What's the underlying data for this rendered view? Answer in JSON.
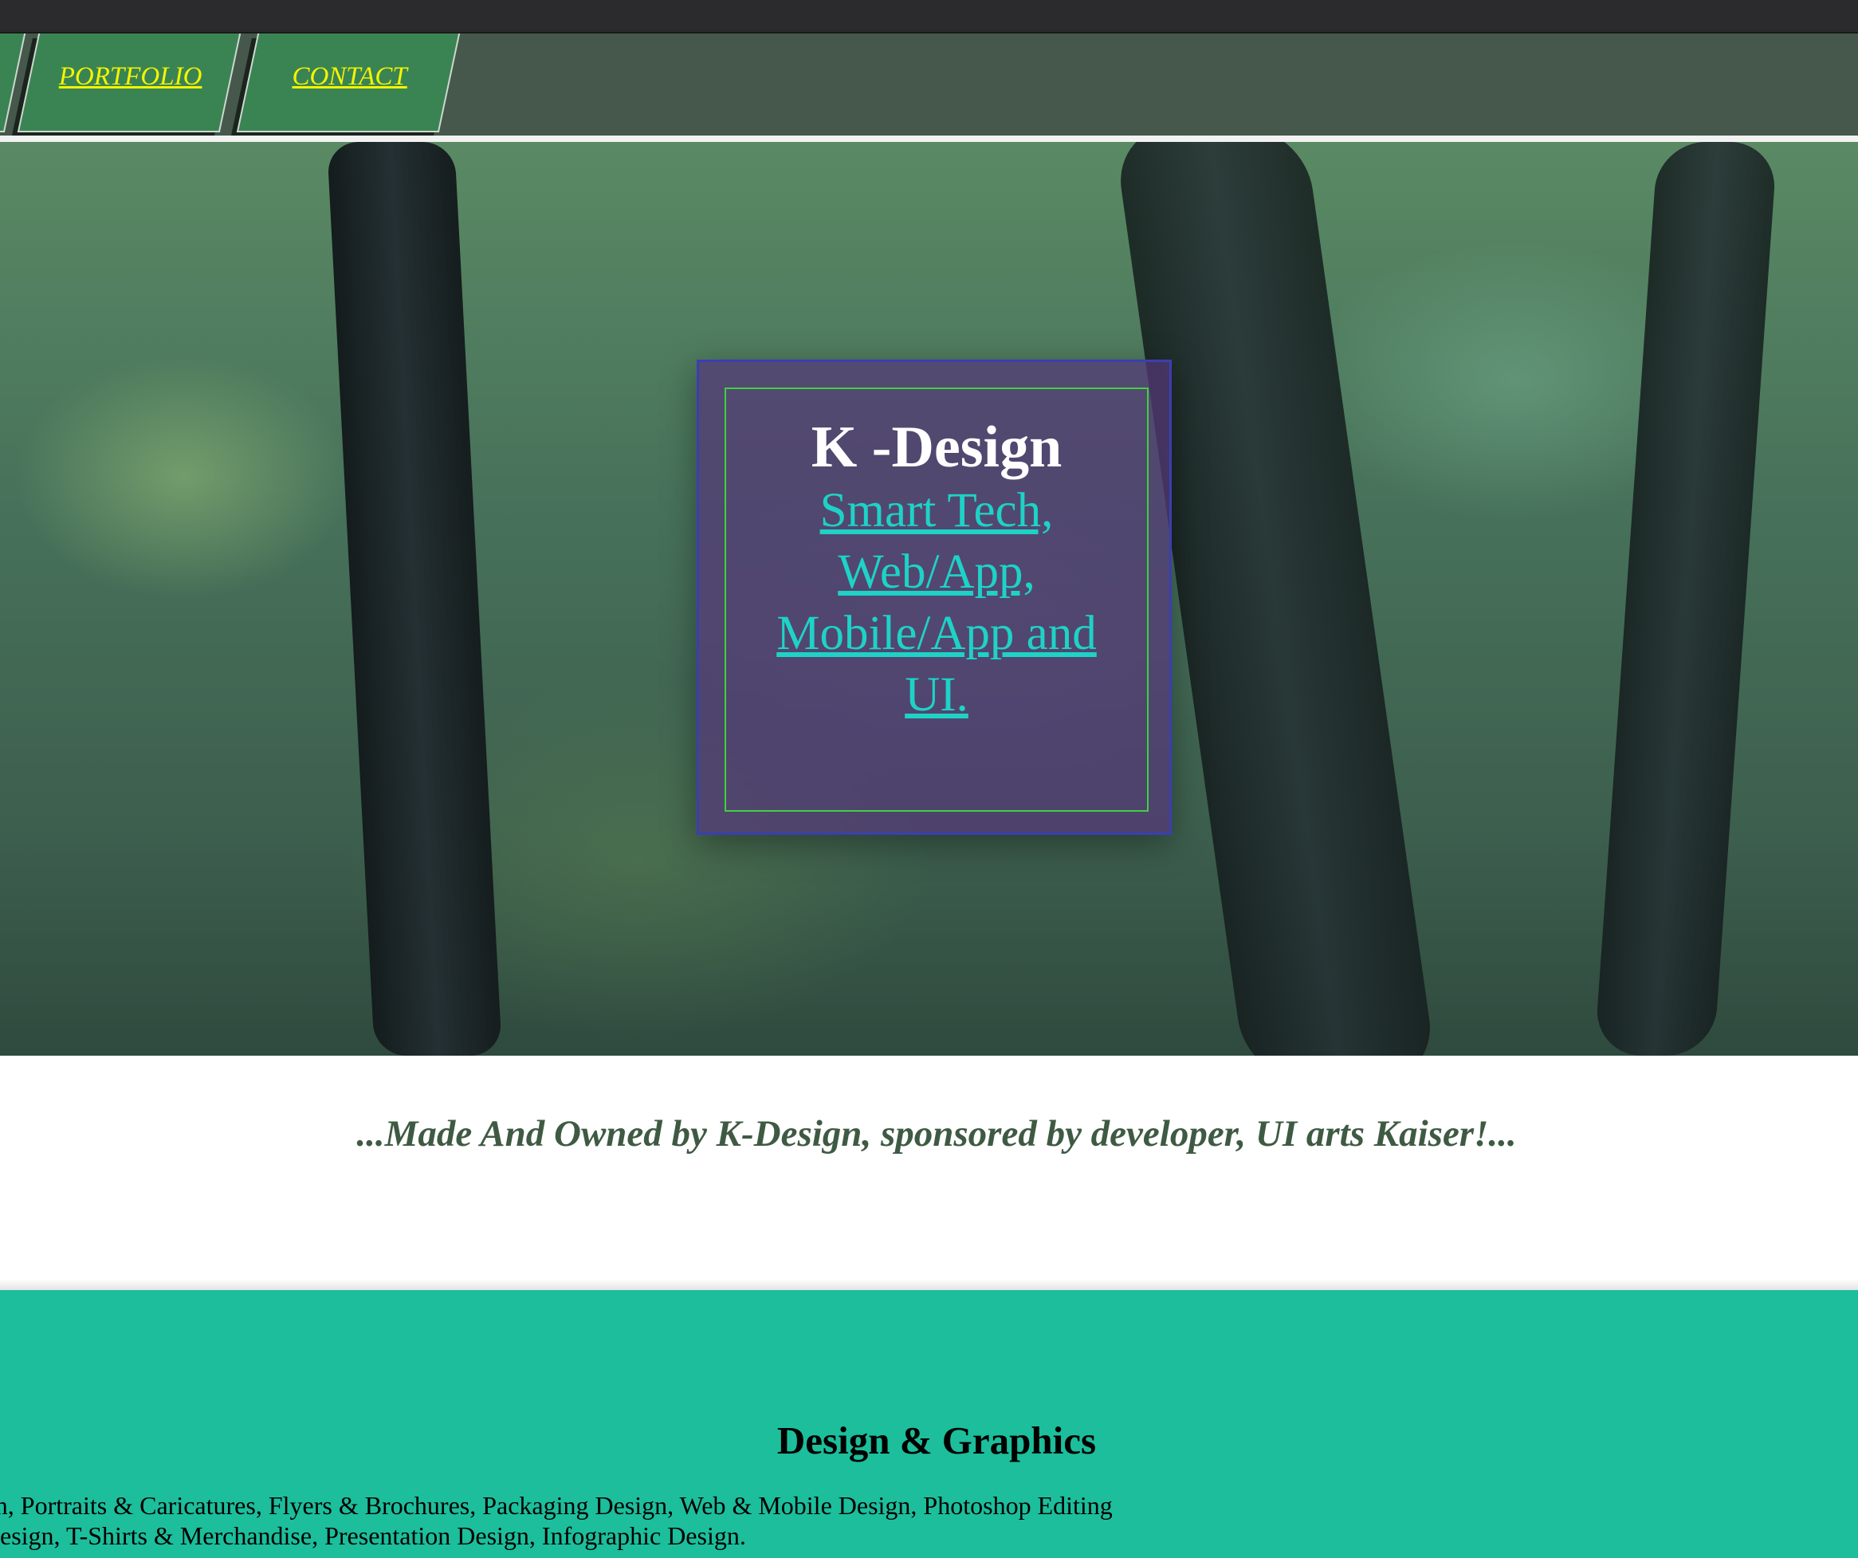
{
  "nav": {
    "tabs": [
      {
        "label": ""
      },
      {
        "label": "PORTFOLIO"
      },
      {
        "label": "CONTACT"
      }
    ]
  },
  "hero": {
    "title": "K -Design",
    "subtitle": "Smart Tech, Web/App, Mobile/App and UI."
  },
  "tagline": "...Made And Owned by K-Design, sponsored by developer, UI arts Kaiser!...",
  "services": {
    "title": "Design & Graphics",
    "line1": "tion, Portraits & Caricatures, Flyers & Brochures, Packaging Design, Web & Mobile Design, Photoshop Editing",
    "line2": "t Design, T-Shirts & Merchandise, Presentation Design, Infographic Design."
  },
  "colors": {
    "nav_bg": "#45584b",
    "tab_bg": "#3a8454",
    "link_yellow": "#f4f400",
    "hero_link": "#1ed2c6",
    "services_bg": "#1cbe9c",
    "tagline": "#3f5a43"
  }
}
